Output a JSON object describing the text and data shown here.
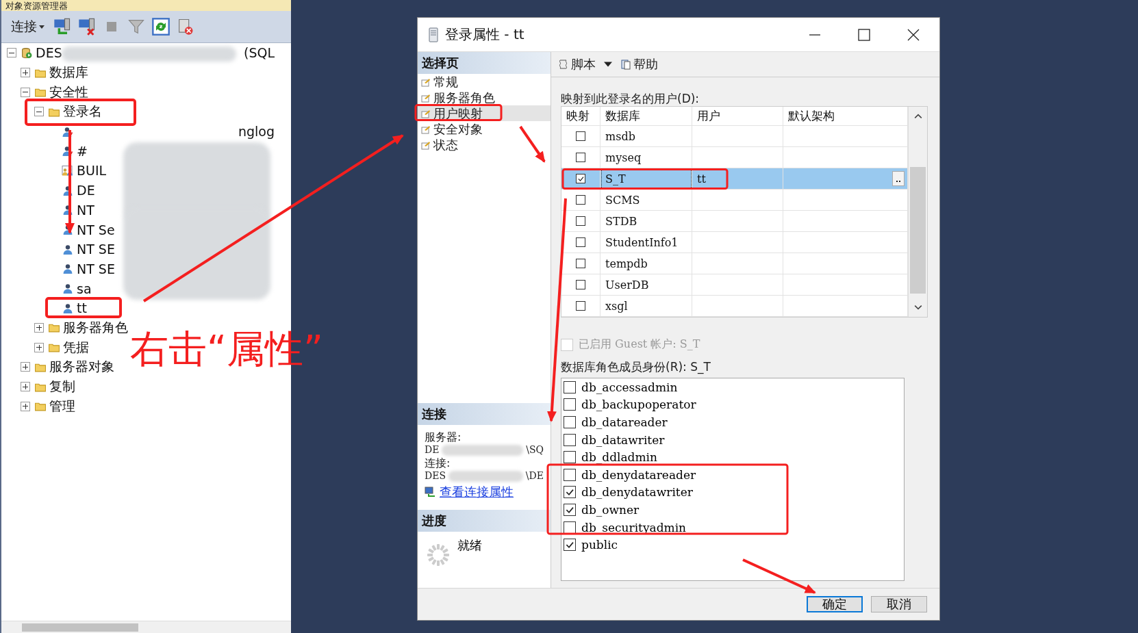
{
  "explorer": {
    "title": "对象资源管理器",
    "connect_label": "连接",
    "tree": [
      {
        "label": "DES",
        "suffix": "(SQL",
        "kind": "server",
        "expanded": true,
        "children": [
          {
            "label": "数据库",
            "kind": "folder",
            "expanded": false
          },
          {
            "label": "安全性",
            "kind": "folder",
            "expanded": true,
            "children": [
              {
                "label": "登录名",
                "kind": "folder",
                "expanded": true,
                "children": [
                  {
                    "kind": "login-disabled",
                    "suffix": "nglog"
                  },
                  {
                    "label": "#",
                    "kind": "login-disabled"
                  },
                  {
                    "label": "BUIL",
                    "kind": "group"
                  },
                  {
                    "label": "DE",
                    "kind": "login"
                  },
                  {
                    "label": "NT",
                    "kind": "login"
                  },
                  {
                    "label": "NT Se",
                    "kind": "login"
                  },
                  {
                    "label": "NT SE",
                    "kind": "login"
                  },
                  {
                    "label": "NT SE",
                    "kind": "login"
                  },
                  {
                    "label": "sa",
                    "kind": "login"
                  },
                  {
                    "label": "tt",
                    "kind": "login"
                  }
                ]
              },
              {
                "label": "服务器角色",
                "kind": "folder",
                "expanded": false
              },
              {
                "label": "凭据",
                "kind": "folder",
                "expanded": false
              }
            ]
          },
          {
            "label": "服务器对象",
            "kind": "folder",
            "expanded": false
          },
          {
            "label": "复制",
            "kind": "folder",
            "expanded": false
          },
          {
            "label": "管理",
            "kind": "folder",
            "expanded": false
          }
        ]
      }
    ]
  },
  "dialog": {
    "title": "登录属性 - tt",
    "pages_header": "选择页",
    "pages": [
      {
        "label": "常规",
        "selected": false
      },
      {
        "label": "服务器角色",
        "selected": false
      },
      {
        "label": "用户映射",
        "selected": true
      },
      {
        "label": "安全对象",
        "selected": false
      },
      {
        "label": "状态",
        "selected": false
      }
    ],
    "connection": {
      "header": "连接",
      "server_label": "服务器:",
      "server_start": "DE",
      "server_end": "\\SQ",
      "connection_label": "连接:",
      "connection_start": "DES",
      "connection_end": "\\DE",
      "link": "查看连接属性"
    },
    "progress": {
      "header": "进度",
      "status": "就绪"
    },
    "toolbar": {
      "script": "脚本",
      "help": "帮助"
    },
    "mapping_label": "映射到此登录名的用户(D):",
    "columns": [
      "映射",
      "数据库",
      "用户",
      "默认架构"
    ],
    "rows": [
      {
        "mapped": false,
        "database": "msdb",
        "selected": false
      },
      {
        "mapped": false,
        "database": "myseq",
        "selected": false
      },
      {
        "mapped": true,
        "database": "S_T",
        "user": "tt",
        "selected": true
      },
      {
        "mapped": false,
        "database": "SCMS",
        "selected": false
      },
      {
        "mapped": false,
        "database": "STDB",
        "selected": false
      },
      {
        "mapped": false,
        "database": "StudentInfo1",
        "selected": false
      },
      {
        "mapped": false,
        "database": "tempdb",
        "selected": false
      },
      {
        "mapped": false,
        "database": "UserDB",
        "selected": false
      },
      {
        "mapped": false,
        "database": "xsgl",
        "selected": false
      }
    ],
    "guest": {
      "label": "已启用 Guest 帐户: S_T",
      "checked": false,
      "disabled": true
    },
    "roles_label": "数据库角色成员身份(R): S_T",
    "roles": [
      {
        "name": "db_accessadmin",
        "checked": false
      },
      {
        "name": "db_backupoperator",
        "checked": false
      },
      {
        "name": "db_datareader",
        "checked": false
      },
      {
        "name": "db_datawriter",
        "checked": false
      },
      {
        "name": "db_ddladmin",
        "checked": false
      },
      {
        "name": "db_denydatareader",
        "checked": false
      },
      {
        "name": "db_denydatawriter",
        "checked": true
      },
      {
        "name": "db_owner",
        "checked": true
      },
      {
        "name": "db_securityadmin",
        "checked": false
      },
      {
        "name": "public",
        "checked": true
      }
    ],
    "buttons": [
      {
        "label": "确定",
        "default": true
      },
      {
        "label": "取消",
        "default": false
      }
    ]
  },
  "annotation": {
    "text": "右击“属性”"
  }
}
